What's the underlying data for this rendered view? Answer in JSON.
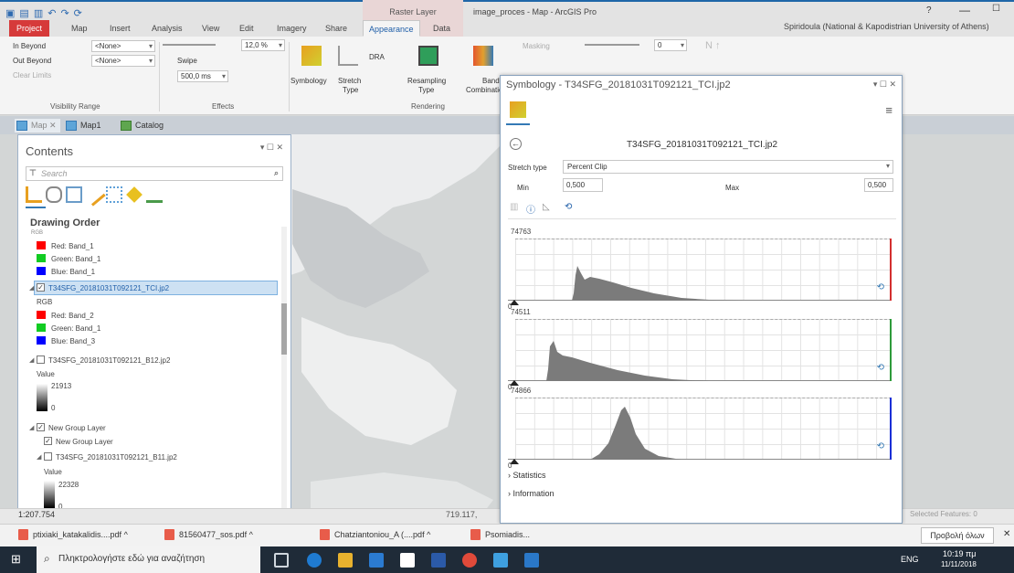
{
  "window": {
    "contextual_tab_group": "Raster Layer",
    "title": "image_proces - Map - ArcGIS Pro",
    "help": "?",
    "minimize": "—",
    "maximize": "☐",
    "user": "Spiridoula (National & Kapodistrian University of Athens)"
  },
  "tabs": [
    "Project",
    "Map",
    "Insert",
    "Analysis",
    "View",
    "Edit",
    "Imagery",
    "Share",
    "Appearance",
    "Data"
  ],
  "ribbon": {
    "in_beyond": "In Beyond",
    "out_beyond": "Out Beyond",
    "clear_limits": "Clear Limits",
    "none1": "<None>",
    "none2": "<None>",
    "visibility_range": "Visibility Range",
    "transparency": "12,0 %",
    "swipe": "Swipe",
    "flicker_ms": "500,0 ms",
    "effects": "Effects",
    "symbology": "Symbology",
    "stretch_type": "Stretch",
    "stretch_type2": "Type",
    "dra": "DRA",
    "resampling": "Resampling",
    "resampling2": "Type",
    "band": "Band",
    "band_combination": "Combination",
    "rendering": "Rendering",
    "masking": "Masking",
    "gamma": "0"
  },
  "view_tabs": [
    "Map",
    "Map1",
    "Catalog"
  ],
  "contents": {
    "title": "Contents",
    "win_buttons": "▾ ☐ ✕",
    "search_placeholder": "Search",
    "drawing_order": "Drawing Order",
    "rgb_cut": "RGB",
    "layer1_bands": [
      "Red: Band_1",
      "Green: Band_1",
      "Blue: Band_1"
    ],
    "layer_tci": "T34SFG_20181031T092121_TCI.jp2",
    "rgb": "RGB",
    "tci_bands": [
      "Red: Band_2",
      "Green: Band_1",
      "Blue: Band_3"
    ],
    "layer_b12": "T34SFG_20181031T092121_B12.jp2",
    "value": "Value",
    "b12_max": "21913",
    "b12_min": "0",
    "group_layer": "New Group Layer",
    "group_sublayer": "New Group Layer",
    "layer_b11": "T34SFG_20181031T092121_B11.jp2",
    "value2": "Value",
    "b11_max": "22328",
    "b11_min": "0"
  },
  "status": {
    "scale": "1:207.754",
    "coords": "719.117,",
    "selected_features": "Selected Features: 0"
  },
  "symbology": {
    "title": "Symbology - T34SFG_20181031T092121_TCI.jp2",
    "win_buttons": "▾ ☐ ✕",
    "layer_name": "T34SFG_20181031T092121_TCI.jp2",
    "stretch_type_label": "Stretch type",
    "stretch_type_value": "Percent Clip",
    "min_label": "Min",
    "min_value": "0,500",
    "max_label": "Max",
    "max_value": "0,500",
    "histograms": [
      {
        "band": "red",
        "max": "74763",
        "min": "0",
        "color": "#d32f2f"
      },
      {
        "band": "green",
        "max": "74511",
        "min": "0",
        "color": "#2e9b3a"
      },
      {
        "band": "blue",
        "max": "74866",
        "min": "0",
        "color": "#1a2fd6"
      }
    ],
    "statistics": "Statistics",
    "information": "Information"
  },
  "downloads": [
    "ptixiaki_katakalidis....pdf",
    "81560477_sos.pdf",
    "Chatziantoniou_A (....pdf",
    "Psomiadis..."
  ],
  "show_all": "Προβολή όλων",
  "taskbar": {
    "search": "Πληκτρολογήστε εδώ για αναζήτηση",
    "lang": "ENG",
    "time": "10:19 πμ",
    "date": "11/11/2018"
  }
}
